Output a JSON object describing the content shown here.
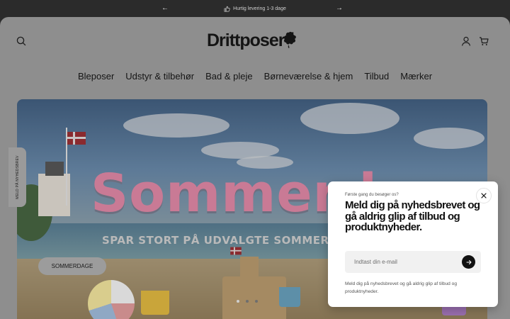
{
  "announcement": {
    "text": "Hurtig levering 1-3 dage",
    "icon": "thumbs-up-icon",
    "prev_icon": "arrow-left-icon",
    "next_icon": "arrow-right-icon"
  },
  "header": {
    "logo_text": "Drittposer",
    "search_icon": "search-icon",
    "account_icon": "user-icon",
    "cart_icon": "shopping-bag-icon"
  },
  "nav": {
    "items": [
      "Bleposer",
      "Udstyr & tilbehør",
      "Bad & pleje",
      "Børneværelse & hjem",
      "Tilbud",
      "Mærker"
    ]
  },
  "hero": {
    "title": "Sommerd",
    "subtitle": "SPAR STORT PÅ UDVALGTE SOMMER",
    "button_label": "SOMMERDAGE",
    "slide_count": 3,
    "active_slide": 1
  },
  "side_tab": {
    "label": "MELD PÅ NYHEDSBREV"
  },
  "popup": {
    "eyebrow": "Første gang du besøger os?",
    "heading": "Meld dig på nyhedsbrevet og gå aldrig glip af tilbud og produktnyheder.",
    "email_placeholder": "Indtast din e-mail",
    "email_value": "",
    "fine_print": "Meld dig på nyhedsbrevet og gå aldrig glip af tilbud og produktnyheder.",
    "close_icon": "close-icon",
    "submit_icon": "arrow-right-icon"
  },
  "colors": {
    "overlay_page": "#8e8e8e",
    "announcement_bg": "#2b2b2b",
    "popup_bg": "#ffffff",
    "accent_dark": "#111111"
  }
}
